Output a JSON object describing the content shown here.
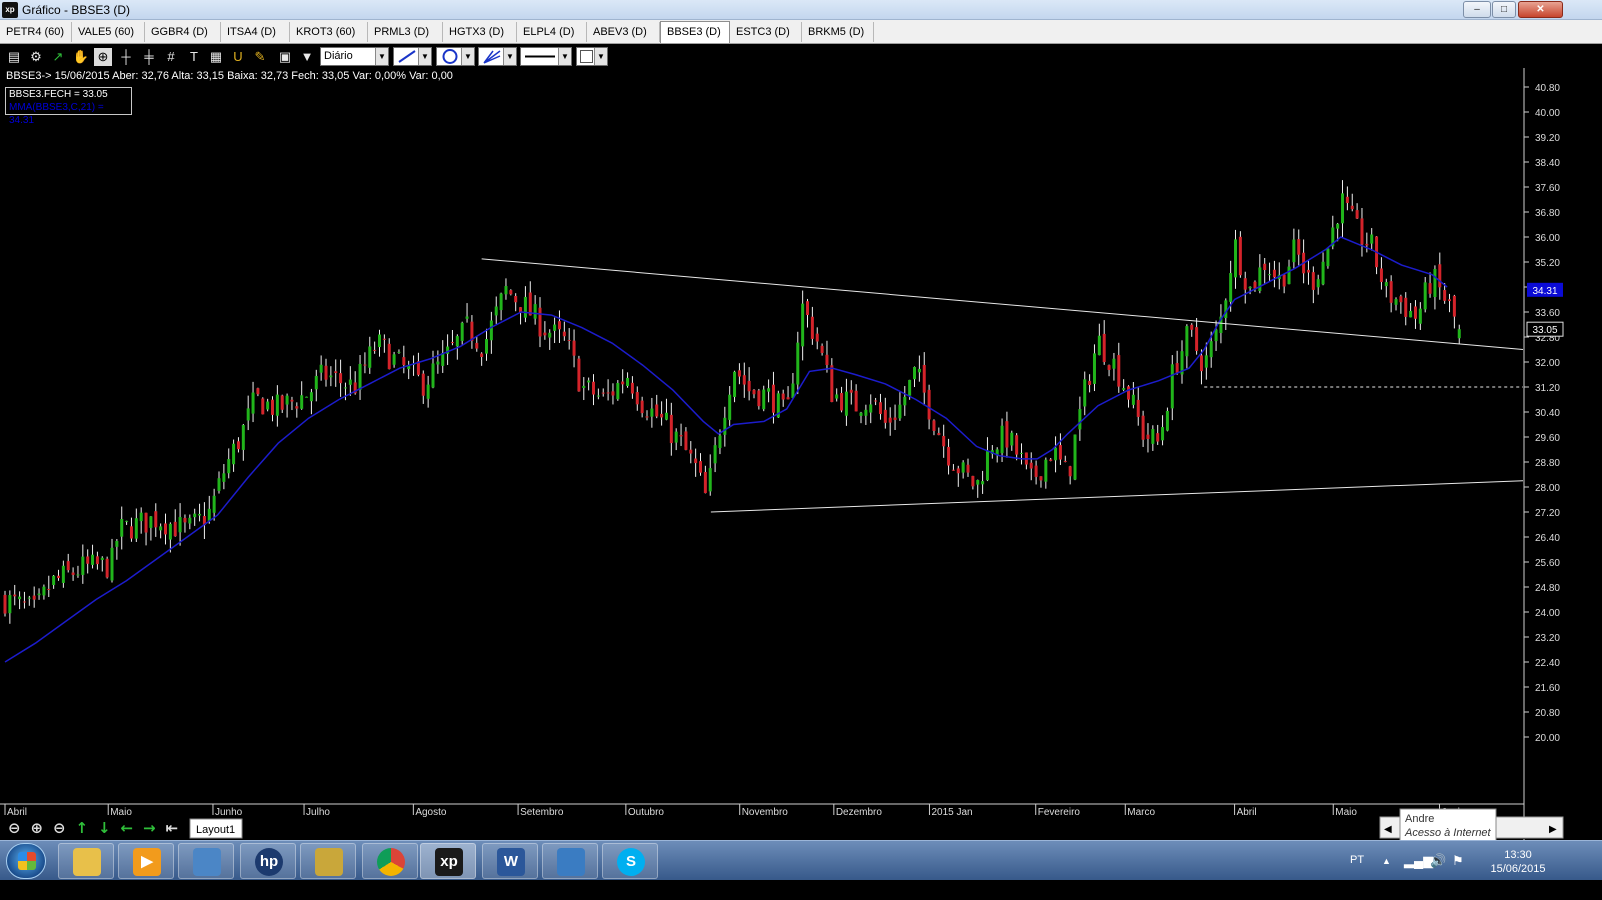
{
  "window": {
    "title": "Gráfico - BBSE3 (D)",
    "app_icon": "xp",
    "min": "–",
    "max": "□",
    "close": "✕"
  },
  "tabs": [
    "PETR4 (60)",
    "VALE5 (60)",
    "GGBR4 (D)",
    "ITSA4 (D)",
    "KROT3 (60)",
    "PRML3 (D)",
    "HGTX3 (D)",
    "ELPL4 (D)",
    "ABEV3 (D)",
    "BBSE3 (D)",
    "ESTC3 (D)",
    "BRKM5 (D)"
  ],
  "active_tab": "BBSE3 (D)",
  "toolbar": {
    "icons": [
      "chart-type-icon",
      "settings-gear-icon",
      "draw-line-icon",
      "hand-pan-icon",
      "zoom-area-icon",
      "crosshair-icon",
      "parallel-lines-icon",
      "hash-icon",
      "text-tool-icon",
      "calculator-icon",
      "magnet-icon",
      "eraser-icon",
      "paste-icon",
      "filter-icon"
    ],
    "period": "Diário",
    "line_tool": "line",
    "shape_tool": "circle",
    "fib_tool": "fib",
    "line_style": "solid",
    "color_swatch": "#ffffff"
  },
  "info_line": "BBSE3-> 15/06/2015 Aber: 32,76 Alta: 33,15 Baixa: 32,73 Fech: 33,05 Var: 0,00% Var: 0,00",
  "legend": {
    "close": "BBSE3.FECH = 33.05",
    "ma": "MMA(BBSE3,C,21) = 34.31"
  },
  "price_labels": {
    "ma": "34.31",
    "close": "33.05"
  },
  "colors": {
    "up": "#21b51b",
    "down": "#d4232a",
    "wick": "#f0f0f0",
    "ma": "#1c1ccc",
    "trend": "#e8e8e8",
    "ma_label_bg": "#0b0bd6"
  },
  "chart_data": {
    "type": "candlestick",
    "title": "",
    "ylim": [
      19.5,
      40.8
    ],
    "y_ticks": [
      "40.80",
      "40.00",
      "39.20",
      "38.40",
      "37.60",
      "36.80",
      "36.00",
      "35.20",
      "34.40",
      "33.60",
      "32.80",
      "32.00",
      "31.20",
      "30.40",
      "29.60",
      "28.80",
      "28.00",
      "27.20",
      "26.40",
      "25.60",
      "24.80",
      "24.00",
      "23.20",
      "22.40",
      "21.60",
      "20.80",
      "20.00"
    ],
    "x_months": [
      {
        "label": "Abril",
        "pos": 0.0
      },
      {
        "label": "Maio",
        "pos": 0.068
      },
      {
        "label": "Junho",
        "pos": 0.137
      },
      {
        "label": "Julho",
        "pos": 0.197
      },
      {
        "label": "Agosto",
        "pos": 0.269
      },
      {
        "label": "Setembro",
        "pos": 0.338
      },
      {
        "label": "Outubro",
        "pos": 0.409
      },
      {
        "label": "Novembro",
        "pos": 0.484
      },
      {
        "label": "Dezembro",
        "pos": 0.546
      },
      {
        "label": "2015 Jan",
        "pos": 0.609
      },
      {
        "label": "Fevereiro",
        "pos": 0.679
      },
      {
        "label": "Marco",
        "pos": 0.738
      },
      {
        "label": "Abril",
        "pos": 0.81
      },
      {
        "label": "Maio",
        "pos": 0.875
      },
      {
        "label": "Junho",
        "pos": 0.945
      }
    ],
    "close_path": [
      [
        0,
        24.4
      ],
      [
        0.02,
        24.0
      ],
      [
        0.03,
        24.9
      ],
      [
        0.05,
        25.4
      ],
      [
        0.07,
        25.5
      ],
      [
        0.075,
        26.6
      ],
      [
        0.1,
        27.0
      ],
      [
        0.12,
        26.6
      ],
      [
        0.135,
        27.2
      ],
      [
        0.145,
        28.6
      ],
      [
        0.155,
        29.6
      ],
      [
        0.165,
        30.8
      ],
      [
        0.18,
        30.5
      ],
      [
        0.2,
        31.0
      ],
      [
        0.21,
        31.6
      ],
      [
        0.23,
        31.2
      ],
      [
        0.245,
        32.6
      ],
      [
        0.26,
        31.9
      ],
      [
        0.275,
        31.3
      ],
      [
        0.29,
        32.1
      ],
      [
        0.305,
        33.1
      ],
      [
        0.315,
        32.5
      ],
      [
        0.33,
        34.3
      ],
      [
        0.34,
        33.9
      ],
      [
        0.355,
        33.1
      ],
      [
        0.37,
        32.6
      ],
      [
        0.38,
        31.2
      ],
      [
        0.395,
        30.8
      ],
      [
        0.41,
        31.6
      ],
      [
        0.42,
        30.7
      ],
      [
        0.435,
        30.0
      ],
      [
        0.445,
        29.4
      ],
      [
        0.455,
        28.6
      ],
      [
        0.462,
        27.6
      ],
      [
        0.47,
        29.7
      ],
      [
        0.48,
        31.9
      ],
      [
        0.49,
        31.1
      ],
      [
        0.505,
        30.9
      ],
      [
        0.515,
        30.2
      ],
      [
        0.525,
        33.8
      ],
      [
        0.535,
        32.7
      ],
      [
        0.545,
        31.0
      ],
      [
        0.56,
        30.6
      ],
      [
        0.57,
        30.9
      ],
      [
        0.58,
        30.0
      ],
      [
        0.59,
        30.6
      ],
      [
        0.6,
        31.7
      ],
      [
        0.61,
        30.4
      ],
      [
        0.62,
        29.2
      ],
      [
        0.63,
        28.5
      ],
      [
        0.64,
        28.0
      ],
      [
        0.65,
        29.4
      ],
      [
        0.66,
        29.6
      ],
      [
        0.67,
        28.8
      ],
      [
        0.675,
        28.1
      ],
      [
        0.69,
        29.2
      ],
      [
        0.7,
        28.3
      ],
      [
        0.71,
        30.8
      ],
      [
        0.72,
        32.7
      ],
      [
        0.73,
        32.0
      ],
      [
        0.74,
        31.0
      ],
      [
        0.75,
        29.7
      ],
      [
        0.76,
        29.4
      ],
      [
        0.77,
        31.8
      ],
      [
        0.78,
        32.9
      ],
      [
        0.79,
        31.9
      ],
      [
        0.8,
        33.1
      ],
      [
        0.81,
        35.8
      ],
      [
        0.82,
        34.3
      ],
      [
        0.83,
        35.2
      ],
      [
        0.84,
        34.6
      ],
      [
        0.85,
        35.6
      ],
      [
        0.86,
        34.5
      ],
      [
        0.87,
        35.4
      ],
      [
        0.88,
        37.2
      ],
      [
        0.89,
        36.2
      ],
      [
        0.9,
        35.7
      ],
      [
        0.91,
        34.2
      ],
      [
        0.92,
        33.9
      ],
      [
        0.93,
        33.4
      ],
      [
        0.94,
        34.7
      ],
      [
        0.95,
        33.9
      ],
      [
        0.958,
        33.05
      ]
    ],
    "ma_path": [
      [
        0,
        22.4
      ],
      [
        0.02,
        23.0
      ],
      [
        0.04,
        23.7
      ],
      [
        0.06,
        24.4
      ],
      [
        0.08,
        25.0
      ],
      [
        0.1,
        25.7
      ],
      [
        0.12,
        26.4
      ],
      [
        0.14,
        27.1
      ],
      [
        0.16,
        28.3
      ],
      [
        0.18,
        29.4
      ],
      [
        0.2,
        30.2
      ],
      [
        0.22,
        30.8
      ],
      [
        0.24,
        31.3
      ],
      [
        0.26,
        31.8
      ],
      [
        0.28,
        32.1
      ],
      [
        0.3,
        32.5
      ],
      [
        0.32,
        33.1
      ],
      [
        0.34,
        33.6
      ],
      [
        0.36,
        33.5
      ],
      [
        0.38,
        33.1
      ],
      [
        0.4,
        32.6
      ],
      [
        0.42,
        31.9
      ],
      [
        0.44,
        31.1
      ],
      [
        0.46,
        30.1
      ],
      [
        0.47,
        29.7
      ],
      [
        0.48,
        30.0
      ],
      [
        0.5,
        30.1
      ],
      [
        0.515,
        30.5
      ],
      [
        0.53,
        31.7
      ],
      [
        0.545,
        31.8
      ],
      [
        0.56,
        31.6
      ],
      [
        0.58,
        31.3
      ],
      [
        0.6,
        30.8
      ],
      [
        0.62,
        30.2
      ],
      [
        0.64,
        29.3
      ],
      [
        0.655,
        29.0
      ],
      [
        0.67,
        28.9
      ],
      [
        0.68,
        28.9
      ],
      [
        0.69,
        29.2
      ],
      [
        0.7,
        29.7
      ],
      [
        0.72,
        30.6
      ],
      [
        0.74,
        31.1
      ],
      [
        0.76,
        31.4
      ],
      [
        0.78,
        31.8
      ],
      [
        0.79,
        32.4
      ],
      [
        0.8,
        33.3
      ],
      [
        0.81,
        34.0
      ],
      [
        0.83,
        34.5
      ],
      [
        0.85,
        35.0
      ],
      [
        0.87,
        35.6
      ],
      [
        0.88,
        36.0
      ],
      [
        0.89,
        35.8
      ],
      [
        0.9,
        35.6
      ],
      [
        0.92,
        35.1
      ],
      [
        0.94,
        34.8
      ],
      [
        0.95,
        34.4
      ]
    ],
    "trendlines": [
      {
        "x1": 0.314,
        "y1": 35.3,
        "x2": 1.0,
        "y2": 32.4
      },
      {
        "x1": 0.465,
        "y1": 27.2,
        "x2": 1.0,
        "y2": 28.2
      },
      {
        "x1": 0.79,
        "y1": 31.2,
        "x2": 1.0,
        "y2": 31.2,
        "dashed": true
      }
    ],
    "last_close": 33.05,
    "last_ma": 34.31
  },
  "bottom": {
    "nav_icons": [
      "zoom-reset-icon",
      "zoom-in-icon",
      "zoom-out-icon",
      "scroll-up-icon",
      "scroll-down-icon",
      "scroll-left-icon",
      "scroll-right-icon",
      "scroll-end-icon"
    ],
    "layout_tab": "Layout1",
    "tooltip_user": "Andre",
    "tooltip_status": "Acesso à Internet",
    "scroll_left": "◀",
    "scroll_right": "▶"
  },
  "taskbar": {
    "apps": [
      "file-explorer-icon",
      "media-player-icon",
      "network-icon",
      "hp-icon",
      "folder-icon",
      "chrome-icon",
      "xp-icon",
      "word-icon",
      "photo-viewer-icon",
      "skype-icon"
    ],
    "app_labels": [
      "",
      "▶",
      "",
      "hp",
      "",
      "",
      "xp",
      "W",
      "",
      "S"
    ],
    "lang": "PT",
    "time": "13:30",
    "date": "15/06/2015"
  }
}
